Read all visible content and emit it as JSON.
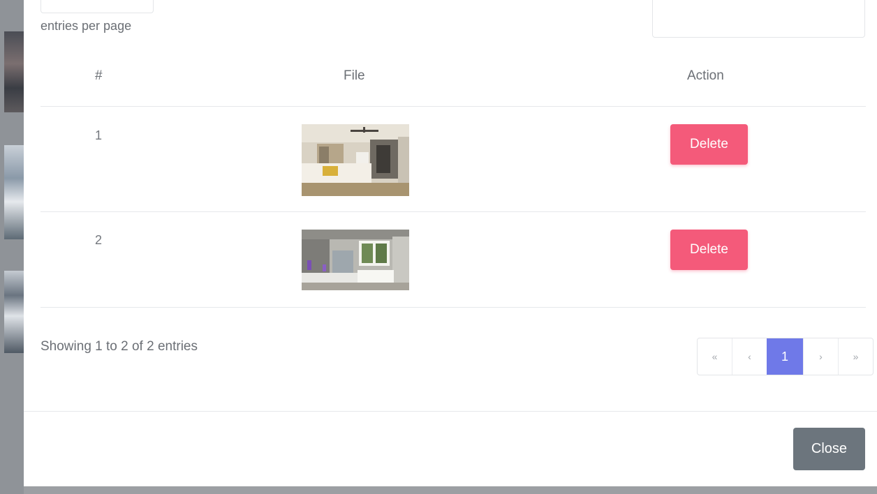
{
  "datatable": {
    "length_label": "entries per page",
    "columns": [
      "#",
      "File",
      "Action"
    ],
    "rows": [
      {
        "index": "1",
        "file_thumbnail": "bedroom-photo",
        "action_label": "Delete"
      },
      {
        "index": "2",
        "file_thumbnail": "bathroom-photo",
        "action_label": "Delete"
      }
    ],
    "info": "Showing 1 to 2 of 2 entries",
    "pagination": {
      "first": "«",
      "prev": "‹",
      "current": "1",
      "next": "›",
      "last": "»"
    }
  },
  "footer": {
    "close_label": "Close"
  },
  "colors": {
    "delete_button": "#f45a7a",
    "active_page": "#6f79e8",
    "close_button": "#6c757d"
  }
}
